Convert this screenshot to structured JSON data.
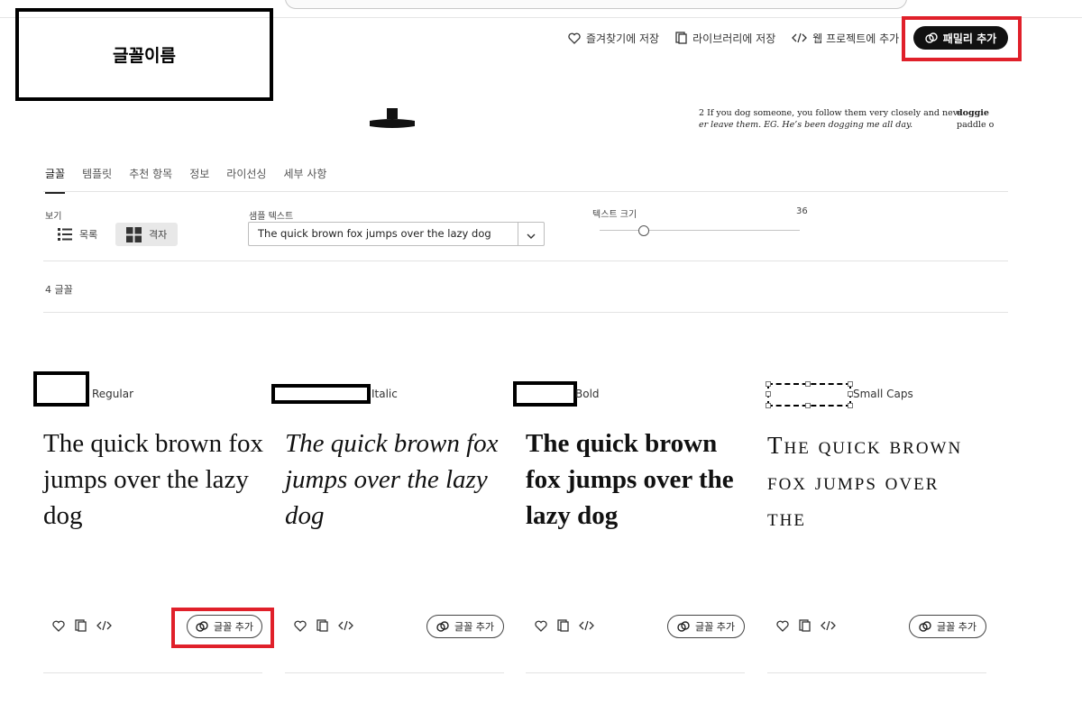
{
  "annotation": {
    "font_name": "글꼴이름"
  },
  "header": {
    "favorite": "즐겨찾기에 저장",
    "library": "라이브러리에 저장",
    "web_project": "웹 프로젝트에 추가",
    "add_family": "패밀리 추가"
  },
  "specimen": {
    "dict_line1": "2 If you dog someone, you follow them very closely and nev-",
    "dict_line2": "er leave them. EG. He’s been dogging me all day.",
    "dict_word": "doggie",
    "dict_word_rest": "paddle o"
  },
  "tabs": [
    "글꼴",
    "템플릿",
    "추천 항목",
    "정보",
    "라이선싱",
    "세부 사항"
  ],
  "controls": {
    "view_label": "보기",
    "view_list": "목록",
    "view_grid": "격자",
    "sample_label": "샘플 텍스트",
    "sample_value": "The quick brown fox jumps over the lazy dog",
    "size_label": "텍스트 크기",
    "size_value": "36",
    "size_fraction": 0.22
  },
  "font_count": "4 글꼴",
  "cards": [
    {
      "style": "Regular",
      "text": "The quick brown fox jumps over the lazy dog",
      "add": "글꼴 추가"
    },
    {
      "style": "Italic",
      "text": "The quick brown fox jumps over the lazy dog",
      "add": "글꼴 추가"
    },
    {
      "style": "Bold",
      "text": "The quick brown fox jumps over the lazy dog",
      "add": "글꼴 추가"
    },
    {
      "style": "Small Caps",
      "text": "The quick brown fox jumps over the",
      "add": "글꼴 추가"
    }
  ]
}
